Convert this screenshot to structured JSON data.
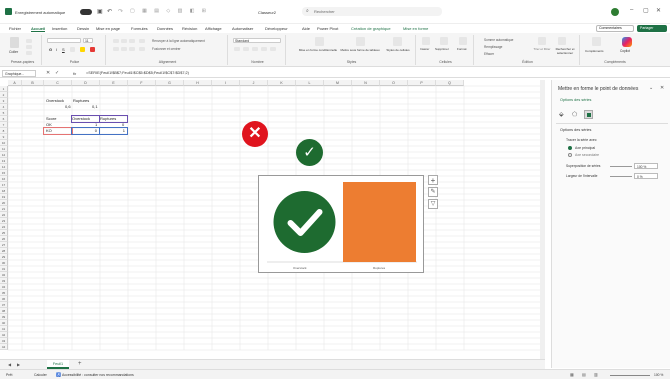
{
  "title": {
    "autosave": "Enregistrement automatique",
    "filename": "Classeur2",
    "app": "Excel",
    "search_placeholder": "Rechercher"
  },
  "tabs": [
    "Fichier",
    "Accueil",
    "Insertion",
    "Dessin",
    "Mise en page",
    "Formules",
    "Données",
    "Révision",
    "Affichage",
    "Automatiser",
    "Développeur",
    "Aide",
    "Power Pivot",
    "Création de graphique",
    "Mise en forme"
  ],
  "toolbar": {
    "comments": "Commentaires",
    "share": "Partager"
  },
  "ribbon_groups": [
    "Presse-papiers",
    "Police",
    "Alignement",
    "Nombre",
    "Styles",
    "Cellules",
    "Édition",
    "Compléments"
  ],
  "ribbon_items": {
    "paste": "Coller",
    "font_size": "11",
    "wrap": "Renvoyer à la ligne automatiquement",
    "merge": "Fusionner et centrer",
    "number_format": "Standard",
    "cond_format": "Mise en forme conditionnelle",
    "table_format": "Mettre sous forme de tableau",
    "cell_styles": "Styles de cellules",
    "insert": "Insérer",
    "delete": "Supprimer",
    "format": "Format",
    "autosum": "Somme automatique",
    "fill": "Remplissage",
    "clear": "Effacer",
    "sort": "Trier et filtrer",
    "find": "Rechercher et sélectionner",
    "addins": "Compléments",
    "copilot": "Copilot"
  },
  "formula_bar": {
    "name_box": "Graphique...",
    "fx": "fx",
    "formula": "=SERIE(Feuil1!$B$7;Feuil1!$C$5:$D$5;Feuil1!$C$7:$D$7;2)"
  },
  "columns": [
    "A",
    "B",
    "C",
    "D",
    "E",
    "F",
    "G",
    "H",
    "I",
    "J",
    "K",
    "L",
    "M",
    "N",
    "O",
    "P",
    "Q"
  ],
  "rows": [
    "1",
    "2",
    "3",
    "4",
    "5",
    "6",
    "7",
    "8",
    "9",
    "10",
    "11",
    "12",
    "13",
    "14",
    "15",
    "16",
    "17",
    "18",
    "19",
    "20",
    "21",
    "22",
    "23",
    "24",
    "25",
    "26",
    "27",
    "28",
    "29",
    "30",
    "31",
    "32",
    "33",
    "34",
    "35",
    "36",
    "37",
    "38",
    "39",
    "40",
    "41",
    "42",
    "43",
    "44"
  ],
  "cells": {
    "overstock_h": "Overstock",
    "ruptures_h": "Ruptures",
    "overstock_v": "0,6",
    "ruptures_v": "0,1",
    "score": "Score",
    "ok": "OK",
    "ko": "KO",
    "t_overstock": "Overstock",
    "t_ruptures": "Ruptures",
    "ok_ov": "1",
    "ok_ru": "0",
    "ko_ov": "0",
    "ko_ru": "1"
  },
  "chart_data": {
    "type": "bar",
    "categories": [
      "Overstock",
      "Ruptures"
    ],
    "series": [
      {
        "name": "KO",
        "values": [
          0,
          1
        ]
      }
    ],
    "colors": {
      "overstock_marker": "#1e6b30",
      "ruptures_bar": "#ed7d31"
    },
    "ylim": [
      0,
      1
    ]
  },
  "pane": {
    "title": "Mettre en forme le point de données",
    "section1": "Options des séries",
    "section2": "Options des séries",
    "plot_on": "Tracer la série avec",
    "primary": "Axe principal",
    "secondary": "Axe secondaire",
    "overlap": "Superposition de séries",
    "overlap_val": "100 %",
    "gap": "Largeur de l'intervalle",
    "gap_val": "0 %"
  },
  "sheet_tab": "Feuil1",
  "status": {
    "ready": "Prêt",
    "calc": "Calculer",
    "accessibility": "Accessibilité : consulter nos recommandations",
    "zoom": "100 %"
  }
}
